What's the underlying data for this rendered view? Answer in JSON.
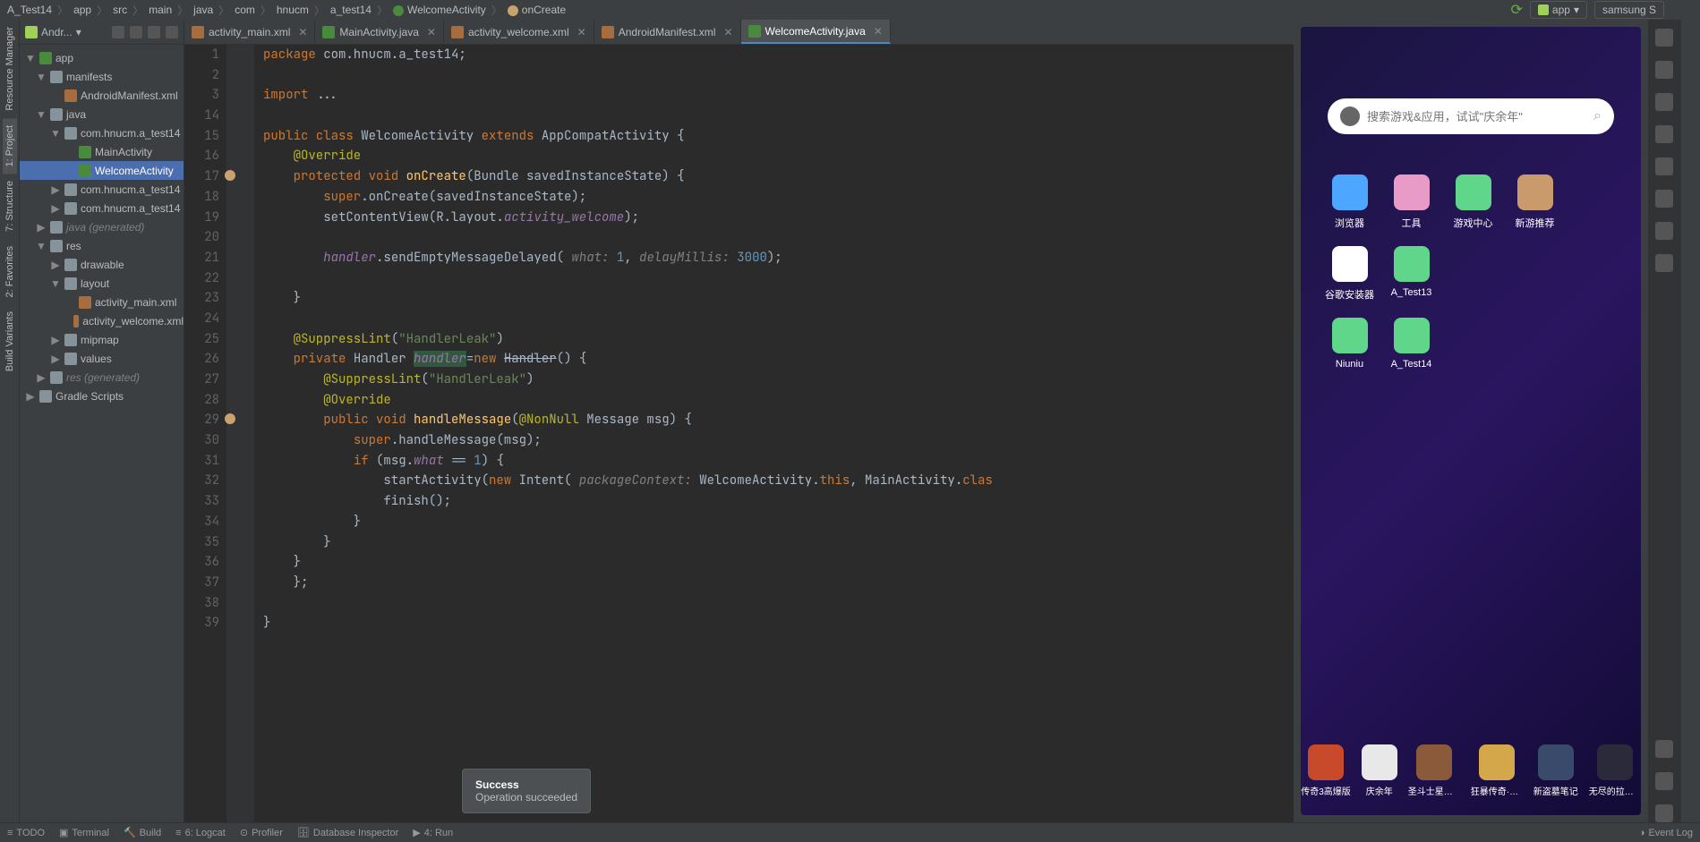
{
  "breadcrumb": [
    "A_Test14",
    "app",
    "src",
    "main",
    "java",
    "com",
    "hnucm",
    "a_test14",
    "WelcomeActivity",
    "onCreate"
  ],
  "run_configs": {
    "app": "app",
    "device": "samsung S"
  },
  "project_panel": {
    "title": "Andr...",
    "tree": [
      {
        "label": "app",
        "type": "module",
        "indent": 0,
        "exp": "▼"
      },
      {
        "label": "manifests",
        "type": "folder",
        "indent": 1,
        "exp": "▼"
      },
      {
        "label": "AndroidManifest.xml",
        "type": "xml",
        "indent": 2,
        "exp": ""
      },
      {
        "label": "java",
        "type": "folder",
        "indent": 1,
        "exp": "▼"
      },
      {
        "label": "com.hnucm.a_test14",
        "type": "folder",
        "indent": 2,
        "exp": "▼"
      },
      {
        "label": "MainActivity",
        "type": "class",
        "indent": 3,
        "exp": ""
      },
      {
        "label": "WelcomeActivity",
        "type": "class",
        "indent": 3,
        "exp": "",
        "sel": true
      },
      {
        "label": "com.hnucm.a_test14",
        "type": "folder",
        "indent": 2,
        "exp": "▶",
        "gen": " "
      },
      {
        "label": "com.hnucm.a_test14",
        "type": "folder",
        "indent": 2,
        "exp": "▶",
        "gen": " "
      },
      {
        "label": "java (generated)",
        "type": "folder",
        "indent": 1,
        "exp": "▶",
        "gen": true
      },
      {
        "label": "res",
        "type": "folder",
        "indent": 1,
        "exp": "▼"
      },
      {
        "label": "drawable",
        "type": "folder",
        "indent": 2,
        "exp": "▶"
      },
      {
        "label": "layout",
        "type": "folder",
        "indent": 2,
        "exp": "▼"
      },
      {
        "label": "activity_main.xml",
        "type": "xml",
        "indent": 3,
        "exp": ""
      },
      {
        "label": "activity_welcome.xml",
        "type": "xml",
        "indent": 3,
        "exp": ""
      },
      {
        "label": "mipmap",
        "type": "folder",
        "indent": 2,
        "exp": "▶"
      },
      {
        "label": "values",
        "type": "folder",
        "indent": 2,
        "exp": "▶"
      },
      {
        "label": "res (generated)",
        "type": "folder",
        "indent": 1,
        "exp": "▶",
        "gen": true
      },
      {
        "label": "Gradle Scripts",
        "type": "folder",
        "indent": 0,
        "exp": "▶"
      }
    ]
  },
  "tabs": [
    {
      "label": "activity_main.xml",
      "type": "xml"
    },
    {
      "label": "MainActivity.java",
      "type": "class"
    },
    {
      "label": "activity_welcome.xml",
      "type": "xml"
    },
    {
      "label": "AndroidManifest.xml",
      "type": "xml"
    },
    {
      "label": "WelcomeActivity.java",
      "type": "class",
      "active": true
    }
  ],
  "code_lines": [
    {
      "n": 1,
      "html": "<span class='kw'>package</span> com.hnucm.a_test14;"
    },
    {
      "n": 2,
      "html": ""
    },
    {
      "n": 3,
      "html": "<span class='kw'>import</span> ..."
    },
    {
      "n": 14,
      "html": ""
    },
    {
      "n": 15,
      "html": "<span class='kw'>public class</span> WelcomeActivity <span class='kw'>extends</span> AppCompatActivity {"
    },
    {
      "n": 16,
      "html": "    <span class='ann'>@Override</span>"
    },
    {
      "n": 17,
      "html": "    <span class='kw'>protected void</span> <span class='method'>onCreate</span>(Bundle savedInstanceState) {"
    },
    {
      "n": 18,
      "html": "        <span class='kw'>super</span>.onCreate(savedInstanceState);"
    },
    {
      "n": 19,
      "html": "        setContentView(R.layout.<span class='field'>activity_welcome</span>);"
    },
    {
      "n": 20,
      "html": ""
    },
    {
      "n": 21,
      "html": "        <span class='field'>handler</span>.sendEmptyMessageDelayed( <span class='param'>what:</span> <span class='num'>1</span>, <span class='param'>delayMillis:</span> <span class='num'>3000</span>);"
    },
    {
      "n": 22,
      "html": ""
    },
    {
      "n": 23,
      "html": "    }"
    },
    {
      "n": 24,
      "html": ""
    },
    {
      "n": 25,
      "html": "    <span class='ann'>@SuppressLint</span>(<span class='str'>\"HandlerLeak\"</span>)"
    },
    {
      "n": 26,
      "html": "    <span class='kw'>private</span> Handler <span class='highlight field'>handler</span>=<span class='kw'>new</span> <span class='deprecated'>Handler</span>() {"
    },
    {
      "n": 27,
      "html": "        <span class='ann'>@SuppressLint</span>(<span class='str'>\"HandlerLeak\"</span>)"
    },
    {
      "n": 28,
      "html": "        <span class='ann'>@Override</span>"
    },
    {
      "n": 29,
      "html": "        <span class='kw'>public void</span> <span class='method'>handleMessage</span>(<span class='ann'>@NonNull</span> Message msg) {"
    },
    {
      "n": 30,
      "html": "            <span class='kw'>super</span>.handleMessage(msg);"
    },
    {
      "n": 31,
      "html": "            <span class='kw'>if</span> (msg.<span class='field'>what</span> == <span class='num'>1</span>) {"
    },
    {
      "n": 32,
      "html": "                startActivity(<span class='kw'>new</span> Intent( <span class='param'>packageContext:</span> WelcomeActivity.<span class='kw'>this</span>, MainActivity.<span class='kw'>clas</span>"
    },
    {
      "n": 33,
      "html": "                finish();"
    },
    {
      "n": 34,
      "html": "            }"
    },
    {
      "n": 35,
      "html": "        }"
    },
    {
      "n": 36,
      "html": "    }"
    },
    {
      "n": 37,
      "html": "    };"
    },
    {
      "n": 38,
      "html": ""
    },
    {
      "n": 39,
      "html": "}"
    }
  ],
  "toast": {
    "title": "Success",
    "body": "Operation succeeded"
  },
  "emulator": {
    "search_placeholder": "搜索游戏&应用，试试\"庆余年\"",
    "apps_row1": [
      {
        "label": "浏览器",
        "color": "#4da6ff"
      },
      {
        "label": "工具",
        "color": "#e89bc6"
      },
      {
        "label": "游戏中心",
        "color": "#5fd68a"
      },
      {
        "label": "新游推荐",
        "color": "#c99a6b"
      },
      {
        "label": "谷歌安装器",
        "color": "#ffffff"
      },
      {
        "label": "A_Test13",
        "color": "#5fd68a"
      }
    ],
    "apps_row2": [
      {
        "label": "Niuniu",
        "color": "#5fd68a"
      },
      {
        "label": "A_Test14",
        "color": "#5fd68a"
      }
    ],
    "bottom_apps": [
      {
        "label": "传奇3高爆版",
        "color": "#c94a2a"
      },
      {
        "label": "庆余年",
        "color": "#e8e8e8"
      },
      {
        "label": "圣斗士星矢...",
        "color": "#8a5a3a"
      },
      {
        "label": "狂暴传奇·微...",
        "color": "#d4a84a"
      },
      {
        "label": "新盗墓笔记",
        "color": "#3a4a6a"
      },
      {
        "label": "无尽的拉格...",
        "color": "#2a2a3a"
      }
    ]
  },
  "left_rail_tabs": [
    "Resource Manager",
    "1: Project",
    "7: Structure",
    "2: Favorites",
    "Build Variants"
  ],
  "bottom_bar_tabs": [
    "TODO",
    "Terminal",
    "Build",
    "6: Logcat",
    "Profiler",
    "Database Inspector",
    "4: Run"
  ],
  "bottom_right": "Event Log"
}
